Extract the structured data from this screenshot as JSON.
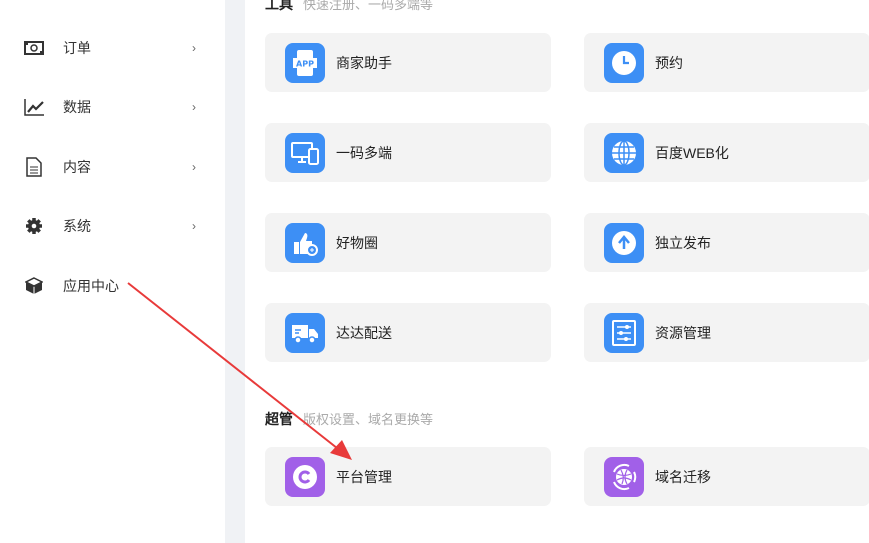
{
  "sidebar": {
    "items": [
      {
        "label": "订单",
        "icon": "money-icon",
        "chevron": "›"
      },
      {
        "label": "数据",
        "icon": "chart-icon",
        "chevron": "›"
      },
      {
        "label": "内容",
        "icon": "document-icon",
        "chevron": "›"
      },
      {
        "label": "系统",
        "icon": "gear-icon",
        "chevron": "›"
      },
      {
        "label": "应用中心",
        "icon": "cube-icon"
      }
    ]
  },
  "sections": {
    "tools": {
      "title": "工具",
      "subtitle": "快速注册、一码多端等",
      "cards": [
        {
          "label": "商家助手",
          "icon": "app-phone-icon"
        },
        {
          "label": "预约",
          "icon": "clock-icon"
        },
        {
          "label": "一码多端",
          "icon": "devices-icon"
        },
        {
          "label": "百度WEB化",
          "icon": "globe-icon"
        },
        {
          "label": "好物圈",
          "icon": "thumbs-up-icon"
        },
        {
          "label": "独立发布",
          "icon": "upload-icon"
        },
        {
          "label": "达达配送",
          "icon": "truck-icon"
        },
        {
          "label": "资源管理",
          "icon": "sliders-icon"
        }
      ]
    },
    "super": {
      "title": "超管",
      "subtitle": "版权设置、域名更换等",
      "cards": [
        {
          "label": "平台管理",
          "icon": "copyright-icon"
        },
        {
          "label": "域名迁移",
          "icon": "globe-transfer-icon"
        }
      ]
    }
  },
  "colors": {
    "tool_icon": "#3d8ff5",
    "super_icon": "#a160e8",
    "annotation_arrow": "#e83a3a"
  }
}
